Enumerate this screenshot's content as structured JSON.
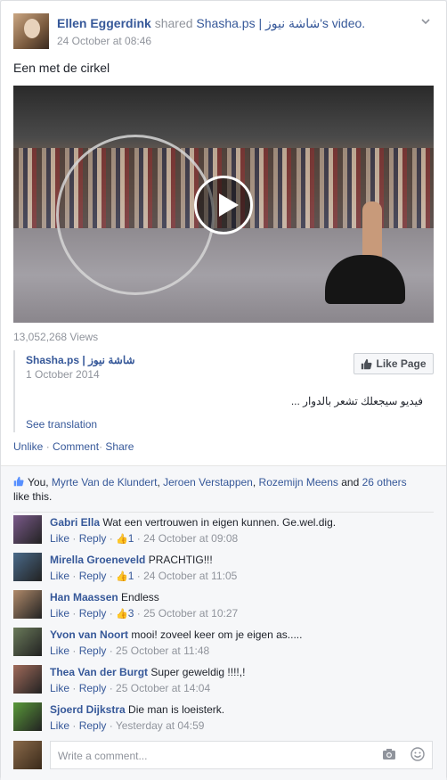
{
  "post": {
    "author": "Ellen Eggerdink",
    "shared_text": "shared",
    "shared_page": "Shasha.ps | شاشة نيوز",
    "shared_suffix": "'s video.",
    "timestamp": "24 October at 08:46",
    "message": "Een met de cirkel"
  },
  "video": {
    "views": "13,052,268 Views"
  },
  "shared_page_box": {
    "name": "Shasha.ps | شاشة نيوز",
    "date": "1 October 2014",
    "like_page_label": "Like Page",
    "description": "فيديو سيجعلك تشعر بالدوار ...",
    "see_translation": "See translation"
  },
  "actions": {
    "unlike": "Unlike",
    "comment": "Comment",
    "share": "Share",
    "sep": "·"
  },
  "likes": {
    "names": [
      "You",
      "Myrte Van de Klundert",
      "Jeroen Verstappen",
      "Rozemijn Meens"
    ],
    "and_text": "and",
    "others": "26 others",
    "suffix": "like this."
  },
  "comments": [
    {
      "name": "Gabri Ella",
      "text": "Wat een vertrouwen in eigen kunnen. Ge.wel.dig.",
      "like": "Like",
      "reply": "Reply",
      "likes": "1",
      "time": "24 October at 09:08",
      "avatar_color": "#7a5a8a"
    },
    {
      "name": "Mirella Groeneveld",
      "text": "PRACHTIG!!!",
      "like": "Like",
      "reply": "Reply",
      "likes": "1",
      "time": "24 October at 11:05",
      "avatar_color": "#4a6a8a"
    },
    {
      "name": "Han Maassen",
      "text": "Endless",
      "like": "Like",
      "reply": "Reply",
      "likes": "3",
      "time": "25 October at 10:27",
      "avatar_color": "#b08a6a"
    },
    {
      "name": "Yvon van Noort",
      "text": "mooi! zoveel keer om je eigen as.....",
      "like": "Like",
      "reply": "Reply",
      "likes": "",
      "time": "25 October at 11:48",
      "avatar_color": "#6a7a5a"
    },
    {
      "name": "Thea Van der Burgt",
      "text": "Super geweldig !!!!,!",
      "like": "Like",
      "reply": "Reply",
      "likes": "",
      "time": "25 October at 14:04",
      "avatar_color": "#a06a5a"
    },
    {
      "name": "Sjoerd Dijkstra",
      "text": "Die man is loeisterk.",
      "like": "Like",
      "reply": "Reply",
      "likes": "",
      "time": "Yesterday at 04:59",
      "avatar_color": "#5a9a3a"
    }
  ],
  "composer": {
    "placeholder": "Write a comment..."
  }
}
